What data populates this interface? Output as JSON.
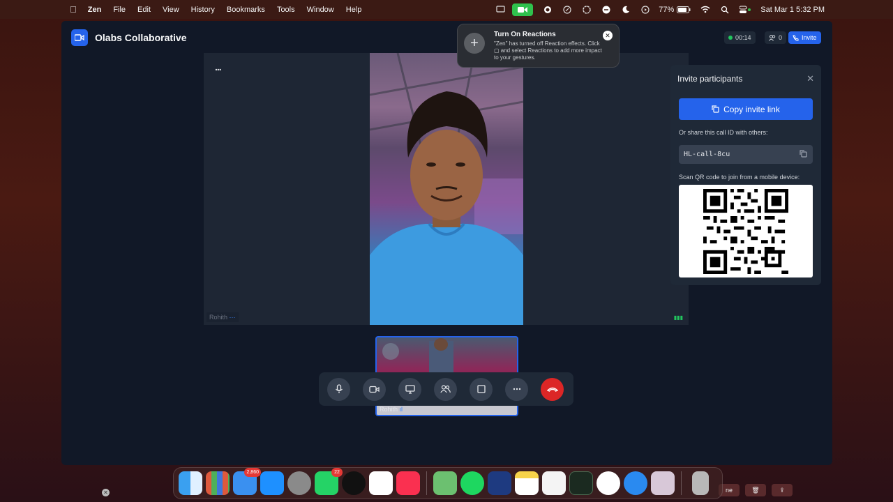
{
  "menubar": {
    "app_name": "Zen",
    "menus": [
      "File",
      "Edit",
      "View",
      "History",
      "Bookmarks",
      "Tools",
      "Window",
      "Help"
    ],
    "battery": "77%",
    "datetime": "Sat Mar 1  5:32 PM"
  },
  "window": {
    "title": "Olabs Collaborative",
    "timer": "00:14",
    "participant_count": "0",
    "invite_label": "Invite"
  },
  "stage": {
    "more_label": "...",
    "main_name": "Rohith",
    "thumb_name": "Rohith"
  },
  "notification": {
    "title": "Turn On Reactions",
    "body": "\"Zen\" has turned off Reaction effects. Click ▢ and select Reactions to add more impact to your gestures."
  },
  "invite_panel": {
    "title": "Invite participants",
    "copy_link_label": "Copy invite link",
    "share_text": "Or share this call ID with others:",
    "call_id": "HL-call-8cu",
    "scan_text": "Scan QR code to join from a mobile device:"
  },
  "controls": [
    "microphone-icon",
    "camera-icon",
    "screen-share-icon",
    "participants-icon",
    "layout-icon",
    "more-icon",
    "end-call-icon"
  ],
  "dock": {
    "mail_badge": "2,860",
    "whatsapp_badge": "22",
    "partial_label": "ne"
  },
  "colors": {
    "accent": "#2563eb",
    "end_call": "#dc2626",
    "window_bg": "#111827"
  }
}
